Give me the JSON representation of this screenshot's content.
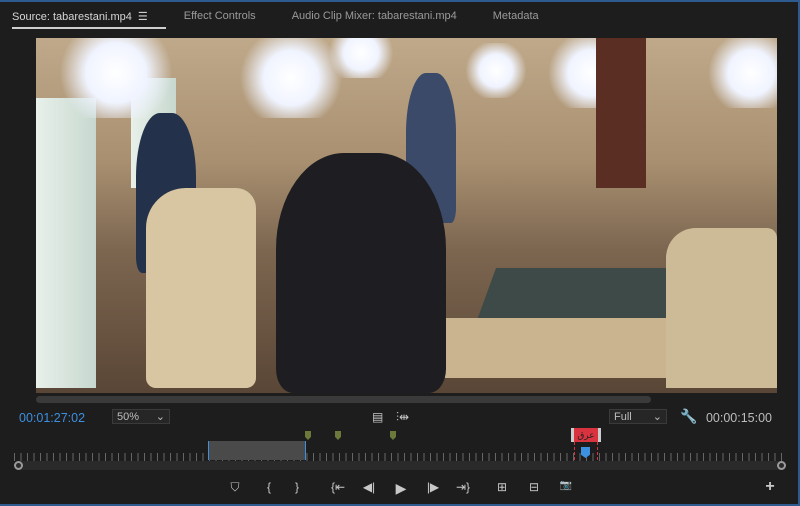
{
  "tabs": [
    {
      "label": "Source: tabarestani.mp4",
      "active": true
    },
    {
      "label": "Effect Controls"
    },
    {
      "label": "Audio Clip Mixer: tabarestani.mp4"
    },
    {
      "label": "Metadata"
    }
  ],
  "menu_icon": "☰",
  "timecode_current": "00:01:27:02",
  "zoom_select": "50%",
  "resolution_select": "Full",
  "timecode_duration": "00:00:15:00",
  "marker_label": "عرق",
  "colors": {
    "accent": "#3d8fe0",
    "marker_red": "#d9333f",
    "marker_green": "#6b7a3a"
  },
  "controls": [
    {
      "name": "add-marker",
      "glyph": "⛉"
    },
    {
      "name": "mark-in",
      "glyph": "{"
    },
    {
      "name": "mark-out",
      "glyph": "}"
    },
    {
      "name": "go-to-in",
      "glyph": "{⇤"
    },
    {
      "name": "step-back",
      "glyph": "◀|"
    },
    {
      "name": "play",
      "glyph": "▶"
    },
    {
      "name": "step-forward",
      "glyph": "|▶"
    },
    {
      "name": "go-to-out",
      "glyph": "⇥}"
    },
    {
      "name": "insert",
      "glyph": "⊞"
    },
    {
      "name": "overwrite",
      "glyph": "⊟"
    },
    {
      "name": "export-frame",
      "glyph": "📷"
    }
  ],
  "add_button": "+"
}
